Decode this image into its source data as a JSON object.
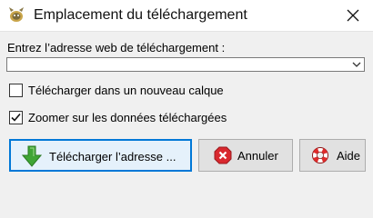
{
  "window": {
    "title": "Emplacement du téléchargement",
    "icon": "gimp-app-icon",
    "close_icon": "close-icon"
  },
  "url_field": {
    "label": "Entrez l’adresse web de téléchargement :",
    "value": "",
    "dropdown_icon": "chevron-down-icon"
  },
  "options": [
    {
      "label": "Télécharger dans un nouveau calque",
      "checked": false
    },
    {
      "label": "Zoomer sur les données téléchargées",
      "checked": true
    }
  ],
  "buttons": {
    "download": {
      "label": "Télécharger l’adresse ...",
      "icon": "download-arrow-icon",
      "color": "#3fa535"
    },
    "cancel": {
      "label": "Annuler",
      "icon": "cancel-icon",
      "color": "#d9282e"
    },
    "help": {
      "label": "Aide",
      "icon": "lifebuoy-icon",
      "color": "#e02a2a"
    }
  },
  "colors": {
    "focus_border": "#0078d7",
    "dialog_bg": "#f0f0f0"
  }
}
